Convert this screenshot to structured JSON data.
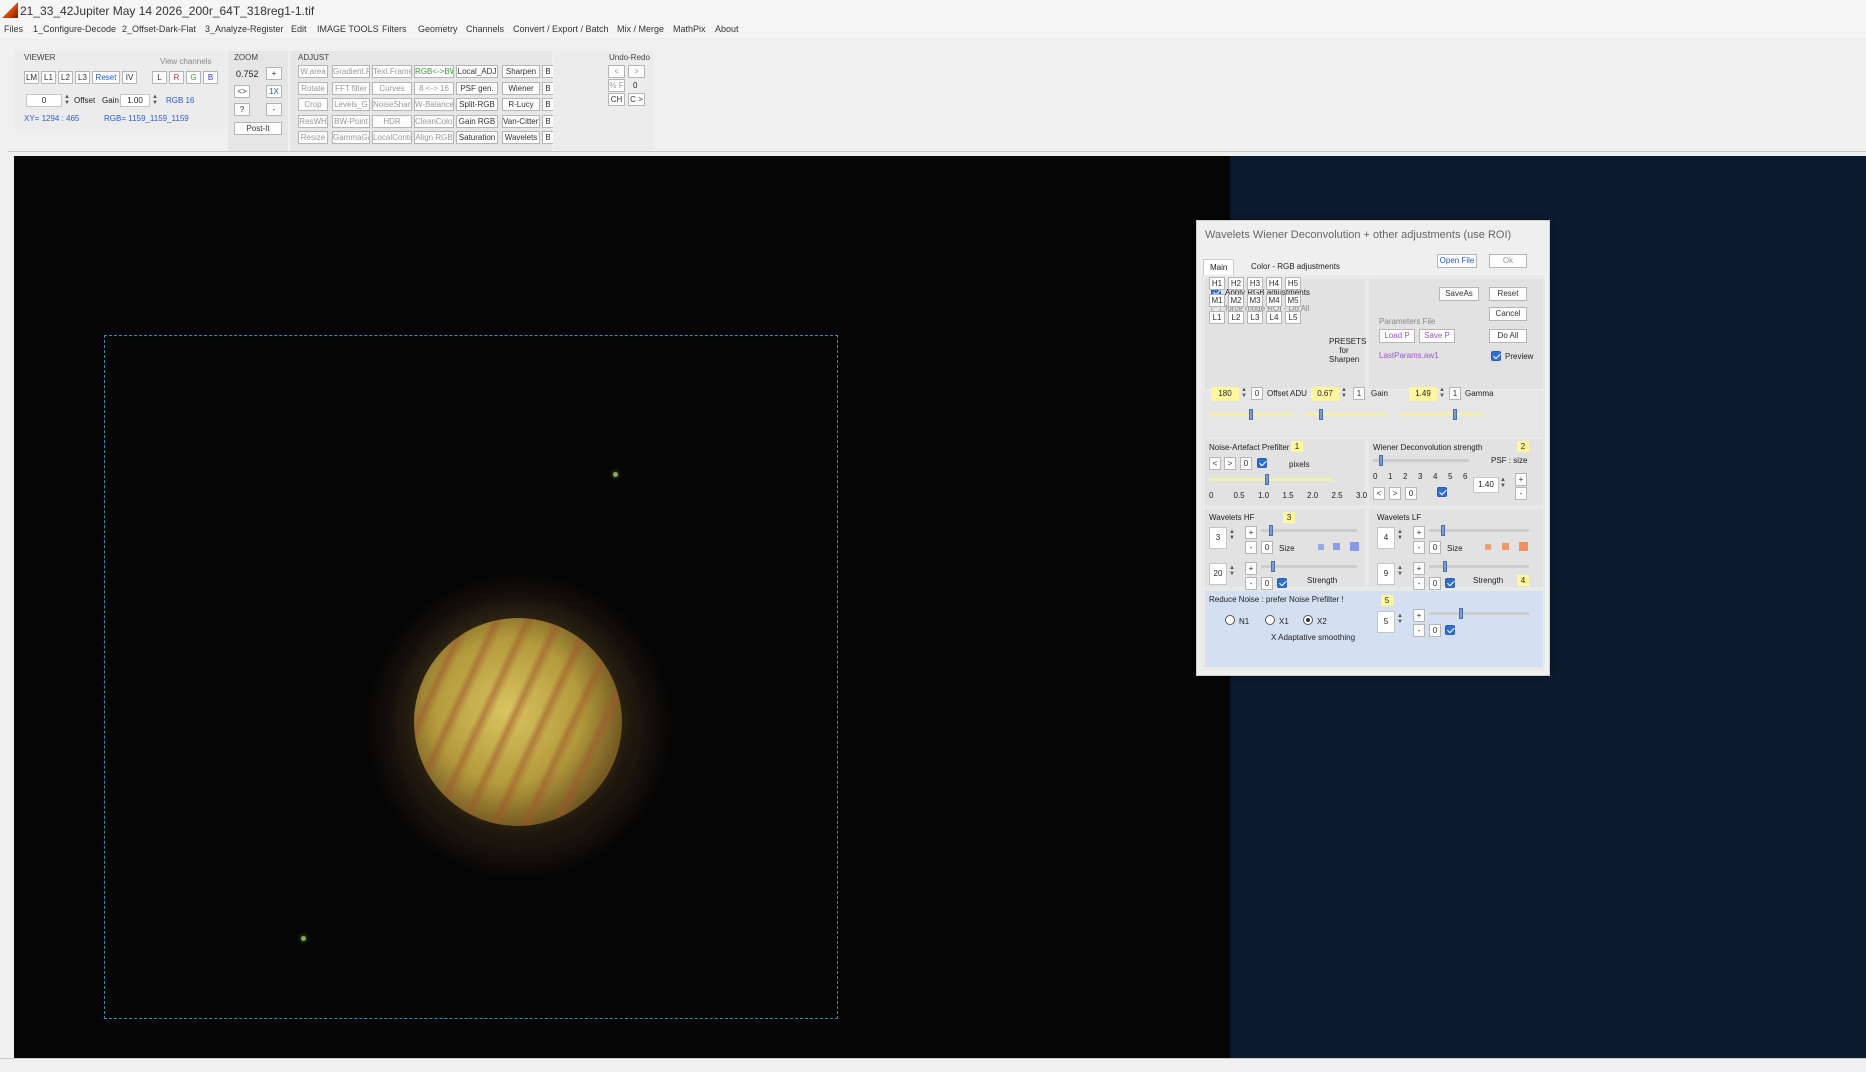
{
  "window": {
    "title": "21_33_42Jupiter May 14 2026_200r_64T_318reg1-1.tif"
  },
  "menu": [
    "Files",
    "1_Configure-Decode",
    "2_Offset-Dark-Flat",
    "3_Analyze-Register",
    "Edit",
    "IMAGE TOOLS",
    "Filters",
    "Geometry",
    "Channels",
    "Convert / Export / Batch",
    "Mix / Merge",
    "MathPix",
    "About"
  ],
  "viewer_group": {
    "label": "VIEWER",
    "view_channels_label": "View channels",
    "buttons": [
      "LM",
      "L1",
      "L2",
      "L3",
      "Reset",
      "IV"
    ],
    "channels": [
      "L",
      "R",
      "G",
      "B"
    ],
    "offset_value": "0",
    "offset_label": "Offset",
    "gain_label": "Gain",
    "gain_value": "1.00",
    "rgb_mode": "RGB 16",
    "xy_readout": "XY= 1294 : 465",
    "rgb_readout": "RGB= 1159_1159_1159"
  },
  "zoom_group": {
    "label": "ZOOM",
    "value": "0.752",
    "plus": "+",
    "fit": "<>",
    "one_x": "1X",
    "help": "?",
    "minus": "-",
    "postit": "Post-It"
  },
  "adjust_group": {
    "label": "ADJUST",
    "rows": [
      [
        "W.area",
        "Gradient.R",
        "Text Frame",
        "RGB<->BW",
        "Local_ADJ",
        "Sharpen",
        "B"
      ],
      [
        "Rotate",
        "FFT filter",
        "Curves",
        "8 <-> 16",
        "PSF gen.",
        "Wiener",
        "B"
      ],
      [
        "Crop",
        "Levels_G",
        "NoiseSharp",
        "W-Balance",
        "Split-RGB",
        "R-Lucy",
        "B"
      ],
      [
        "ResWH",
        "BW-Point",
        "HDR",
        "CleanColor",
        "Gain RGB",
        "Van-Cittert",
        "B"
      ],
      [
        "Resize",
        "GammaGain",
        "LocalContr",
        "Align RGB",
        "Saturation",
        "Wavelets",
        "B"
      ]
    ]
  },
  "undo_group": {
    "label": "Undo-Redo",
    "prev": "<",
    "next": ">",
    "pct": "% F",
    "count": "0",
    "ch": "CH",
    "cgt": "C >"
  },
  "dialog": {
    "title": "Wavelets Wiener Deconvolution + other adjustments    (use ROI)",
    "tabs": [
      "Main",
      "Color - RGB adjustments"
    ],
    "open_file": "Open File",
    "ok": "Ok",
    "apply_rgb": "Apply RGB adjustments",
    "force_mode": "force mode  ROI - Do All",
    "saveas": "SaveAs",
    "reset": "Reset",
    "cancel": "Cancel",
    "do_all": "Do All",
    "params_file_label": "Parameters File",
    "load_p": "Load P",
    "save_p": "Save P",
    "last_params": "LastParams.aw1",
    "preview": "Preview",
    "presets_rows": [
      [
        "H1",
        "H2",
        "H3",
        "H4",
        "H5"
      ],
      [
        "M1",
        "M2",
        "M3",
        "M4",
        "M5"
      ],
      [
        "L1",
        "L2",
        "L3",
        "L4",
        "L5"
      ]
    ],
    "presets_label": "PRESETS for Sharpen",
    "offset_value": "180",
    "offset_reset": "0",
    "offset_label": "Offset ADU",
    "gain_value": "0.67",
    "gain_reset": "1",
    "gain_label": "Gain",
    "gamma_value": "1.49",
    "gamma_reset": "1",
    "gamma_label": "Gamma",
    "noise_prefilter": {
      "label": "Noise-Artefact Prefilter",
      "badge": "1",
      "prev": "<",
      "next": ">",
      "zero": "0",
      "pixels_label": "pixels",
      "scale": [
        "0",
        "0.5",
        "1.0",
        "1.5",
        "2.0",
        "2.5",
        "3.0"
      ]
    },
    "wiener": {
      "label": "Wiener Deconvolution strength",
      "badge": "2",
      "psf_label": "PSF : size",
      "scale": [
        "0",
        "1",
        "2",
        "3",
        "4",
        "5",
        "6"
      ],
      "prev": "<",
      "next": ">",
      "zero": "0",
      "psf_value": "1.40",
      "plus": "+",
      "minus": "-"
    },
    "wavelets_hf": {
      "label": "Wavelets HF",
      "badge": "3",
      "size_value": "3",
      "size_label": "Size",
      "strength_value": "20",
      "strength_label": "Strength",
      "plus": "+",
      "minus": "-",
      "zero": "0"
    },
    "wavelets_lf": {
      "label": "Wavelets LF",
      "size_value": "4",
      "size_label": "Size",
      "strength_value": "9",
      "strength_label": "Strength",
      "badge": "4",
      "plus": "+",
      "minus": "-",
      "zero": "0"
    },
    "reduce_noise": {
      "label": "Reduce Noise :  prefer Noise Prefilter !",
      "badge": "5",
      "options": [
        "N1",
        "X1",
        "X2"
      ],
      "selected": "X2",
      "adaptive_label": "X Adaptative smoothing",
      "value": "5",
      "plus": "+",
      "minus": "-",
      "zero": "0"
    }
  },
  "colors": {
    "accent_blue": "#2f6fce",
    "viewer_bg": "#050505",
    "viewer_right_bg": "#0b1a2e",
    "roi_border": "#2e8fb3"
  }
}
